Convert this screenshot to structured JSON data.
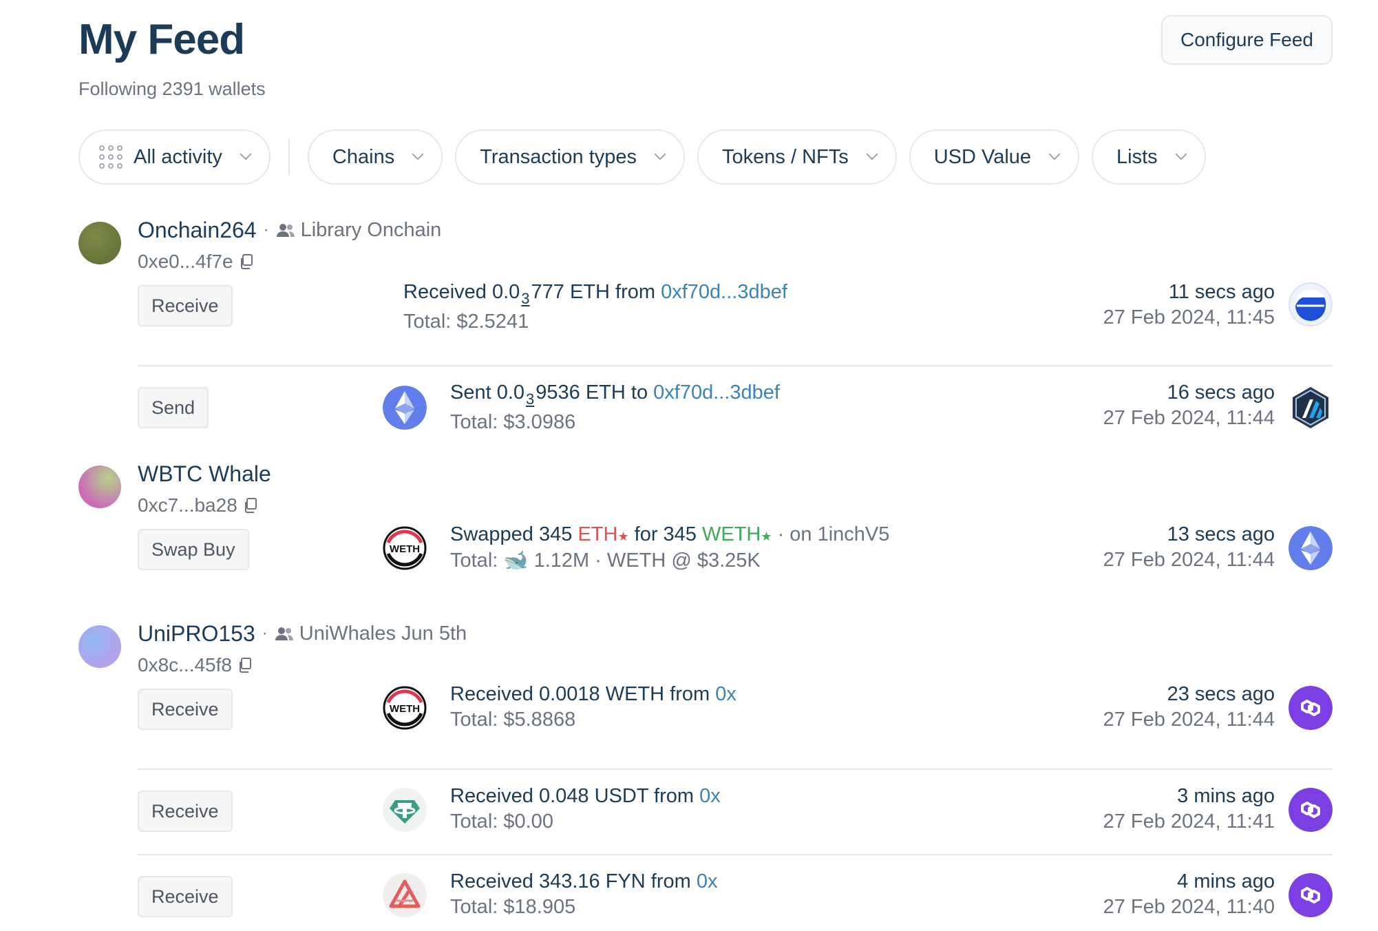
{
  "header": {
    "title": "My Feed",
    "subtitle": "Following 2391 wallets",
    "configure_label": "Configure Feed"
  },
  "filters": [
    {
      "label": "All activity"
    },
    {
      "label": "Chains"
    },
    {
      "label": "Transaction types"
    },
    {
      "label": "Tokens / NFTs"
    },
    {
      "label": "USD Value"
    },
    {
      "label": "Lists"
    }
  ],
  "groups": [
    {
      "name": "Onchain264",
      "label": "Library Onchain",
      "address": "0xe0...4f7e",
      "avatar_color": "#6b7a3e",
      "txs": [
        {
          "type": "Receive",
          "verb": "Received 0.0",
          "sub": "3",
          "amount": "777 ETH from",
          "counterparty": "0xf70d...3dbef",
          "total": "Total: $2.5241",
          "ago": "11 secs ago",
          "date": "27 Feb 2024, 11:45",
          "chain_icon": "base-chain-icon"
        },
        {
          "type": "Send",
          "verb": "Sent 0.0",
          "sub": "3",
          "amount": "9536 ETH to",
          "counterparty": "0xf70d...3dbef",
          "total": "Total: $3.0986",
          "ago": "16 secs ago",
          "date": "27 Feb 2024, 11:44",
          "token_icon": "eth-icon",
          "chain_icon": "arbitrum-chain-icon"
        }
      ]
    },
    {
      "name": "WBTC Whale",
      "address": "0xc7...ba28",
      "avatar_color": "#c07ec2",
      "txs": [
        {
          "type": "Swap Buy",
          "verb": "Swapped 345",
          "token_a": "ETH",
          "for": "for 345",
          "token_b": "WETH",
          "suffix": "· on 1inchV5",
          "total_prefix": "Total:",
          "total_rest": "1.12M · WETH @ $3.25K",
          "ago": "13 secs ago",
          "date": "27 Feb 2024, 11:44",
          "token_icon": "weth-icon",
          "chain_icon": "ethereum-chain-icon"
        }
      ]
    },
    {
      "name": "UniPRO153",
      "label": "UniWhales Jun 5th",
      "address": "0x8c...45f8",
      "avatar_color": "#a8a4ec",
      "txs": [
        {
          "type": "Receive",
          "line": "Received 0.0018 WETH from",
          "counterparty": "0x",
          "total": "Total: $5.8868",
          "ago": "23 secs ago",
          "date": "27 Feb 2024, 11:44",
          "token_icon": "weth-icon",
          "chain_icon": "polygon-chain-icon"
        },
        {
          "type": "Receive",
          "line": "Received 0.048 USDT from",
          "counterparty": "0x",
          "total": "Total: $0.00",
          "ago": "3 mins ago",
          "date": "27 Feb 2024, 11:41",
          "token_icon": "usdt-icon",
          "chain_icon": "polygon-chain-icon"
        },
        {
          "type": "Receive",
          "line": "Received 343.16 FYN from",
          "counterparty": "0x",
          "total": "Total: $18.905",
          "ago": "4 mins ago",
          "date": "27 Feb 2024, 11:40",
          "token_icon": "fyn-icon",
          "chain_icon": "polygon-chain-icon"
        }
      ]
    }
  ],
  "colors": {
    "title": "#1c3b56",
    "link": "#3b82b6",
    "polygon": "#7b3fe4",
    "eth": "#627eea"
  }
}
